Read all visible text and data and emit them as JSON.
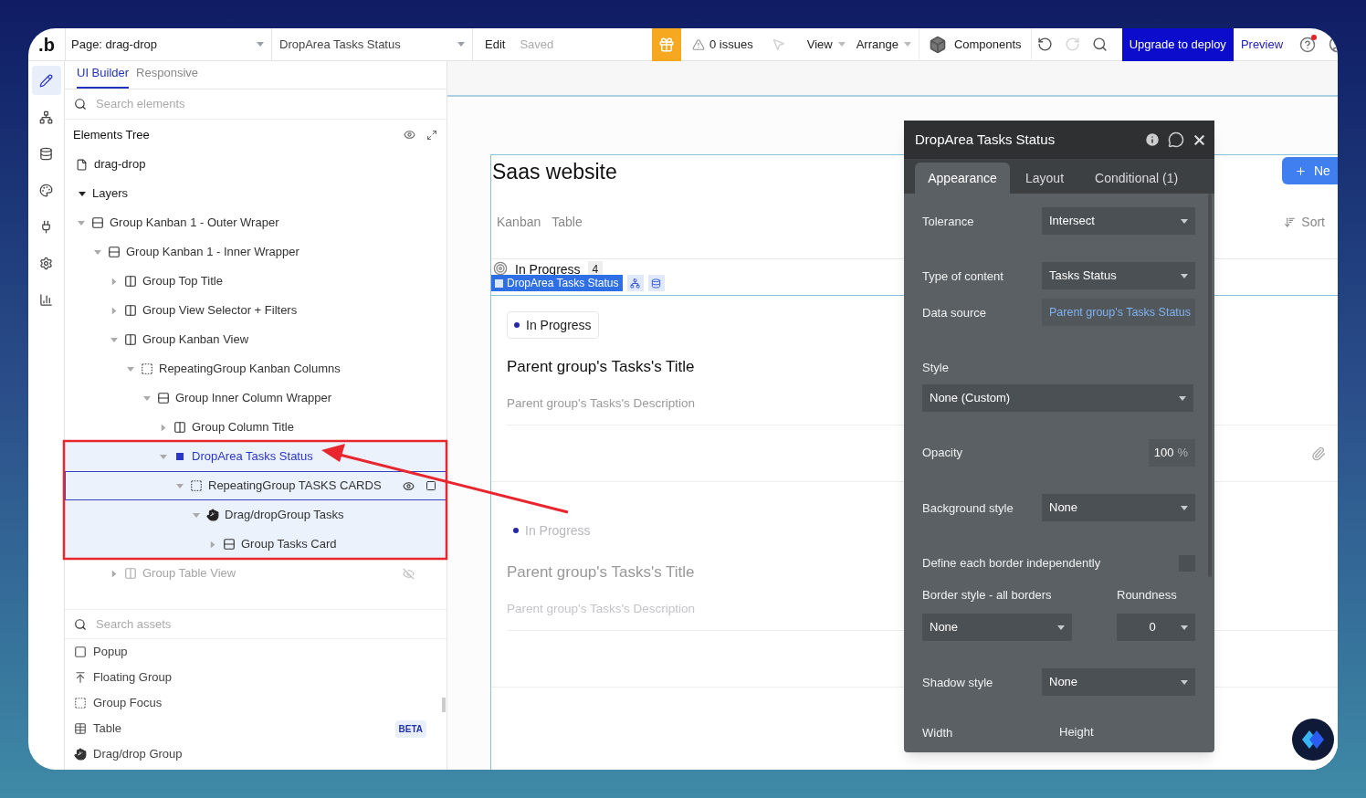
{
  "topbar": {
    "logo": ".b",
    "page_select": "Page: drag-drop",
    "element_select": "DropArea Tasks Status",
    "edit": "Edit",
    "save_status": "Saved",
    "issues": "0 issues",
    "menus": [
      "View",
      "Arrange"
    ],
    "components": "Components",
    "tools": [
      {
        "kind": "undo",
        "disabled": false
      },
      {
        "kind": "redo",
        "disabled": true
      },
      {
        "kind": "search",
        "disabled": false
      }
    ],
    "upgrade": "Upgrade to deploy",
    "preview": "Preview",
    "help_notification": true
  },
  "rail": [
    {
      "kind": "design",
      "selected": true
    },
    {
      "kind": "workflow",
      "selected": false
    },
    {
      "kind": "data",
      "selected": false
    },
    {
      "kind": "styles",
      "selected": false
    },
    {
      "kind": "plugins",
      "selected": false
    },
    {
      "kind": "settings",
      "selected": false
    },
    {
      "kind": "logs",
      "selected": false
    }
  ],
  "left_panel": {
    "tabs": [
      {
        "label": "UI Builder",
        "selected": true
      },
      {
        "label": "Responsive",
        "selected": false
      }
    ],
    "search": {
      "placeholder": "Search elements"
    },
    "tree_title": "Elements Tree",
    "page": "drag-drop",
    "layers": {
      "label": "Layers",
      "expanded": true,
      "children": [
        {
          "label": "Group Kanban 1 - Outer Wraper",
          "kind": "group",
          "expanded": true,
          "selected": false,
          "hovered": false,
          "hidden": false,
          "children": [
            {
              "label": "Group Kanban 1 - Inner Wrapper",
              "kind": "group",
              "expanded": true,
              "selected": false,
              "hovered": false,
              "hidden": false,
              "children": [
                {
                  "label": "Group Top Title",
                  "kind": "column",
                  "expanded": false,
                  "selected": false,
                  "hovered": false,
                  "hidden": false
                },
                {
                  "label": "Group View Selector + Filters",
                  "kind": "column",
                  "expanded": false,
                  "selected": false,
                  "hovered": false,
                  "hidden": false
                },
                {
                  "label": "Group Kanban View",
                  "kind": "column",
                  "expanded": true,
                  "selected": false,
                  "hovered": false,
                  "hidden": false,
                  "children": [
                    {
                      "label": "RepeatingGroup Kanban Columns",
                      "kind": "repeating",
                      "expanded": true,
                      "selected": false,
                      "hovered": false,
                      "hidden": false,
                      "children": [
                        {
                          "label": "Group Inner Column Wrapper",
                          "kind": "group",
                          "expanded": true,
                          "selected": false,
                          "hovered": false,
                          "hidden": false,
                          "children": [
                            {
                              "label": "Group Column Title",
                              "kind": "column",
                              "expanded": false,
                              "selected": false,
                              "hovered": false,
                              "hidden": false
                            },
                            {
                              "label": "DropArea Tasks Status",
                              "kind": "droparea",
                              "expanded": true,
                              "selected": true,
                              "hovered": false,
                              "hidden": false,
                              "children": [
                                {
                                  "label": "RepeatingGroup TASKS CARDS",
                                  "kind": "repeating",
                                  "expanded": true,
                                  "selected": false,
                                  "hovered": true,
                                  "hidden": false,
                                  "children": [
                                    {
                                      "label": "Drag/dropGroup Tasks",
                                      "kind": "dragdrop",
                                      "expanded": true,
                                      "selected": false,
                                      "hovered": false,
                                      "hidden": false,
                                      "children": [
                                        {
                                          "label": "Group Tasks Card",
                                          "kind": "group",
                                          "expanded": false,
                                          "selected": false,
                                          "hovered": false,
                                          "hidden": false
                                        }
                                      ]
                                    }
                                  ]
                                }
                              ]
                            }
                          ]
                        }
                      ]
                    }
                  ]
                },
                {
                  "label": "Group Table View",
                  "kind": "column",
                  "expanded": false,
                  "selected": false,
                  "hovered": false,
                  "hidden": true
                }
              ]
            }
          ]
        }
      ]
    },
    "assets_search": {
      "placeholder": "Search assets"
    },
    "assets": [
      {
        "label": "Popup",
        "kind": "popup"
      },
      {
        "label": "Floating Group",
        "kind": "floating"
      },
      {
        "label": "Group Focus",
        "kind": "focus"
      },
      {
        "label": "Table",
        "kind": "table",
        "badge": "BETA"
      },
      {
        "label": "Drag/drop Group",
        "kind": "dragdrop"
      }
    ]
  },
  "canvas": {
    "page_title": "Saas website",
    "new_button": "Ne",
    "views": [
      "Kanban",
      "Table"
    ],
    "sort": "Sort",
    "column": {
      "title": "In Progress",
      "count": "4"
    },
    "element_tag": "DropArea Tasks Status",
    "cards": [
      {
        "status": "In Progress",
        "color": "#2626a8",
        "title": "Parent group's Tasks's Title",
        "description": "Parent group's Tasks's Description",
        "faded": false
      },
      {
        "status": "In Progress",
        "color": "#2626a8",
        "title": "Parent group's Tasks's Title",
        "description": "Parent group's Tasks's Description",
        "faded": true
      }
    ]
  },
  "panel": {
    "title": "DropArea Tasks Status",
    "tabs": [
      {
        "label": "Appearance",
        "selected": true
      },
      {
        "label": "Layout",
        "selected": false
      },
      {
        "label": "Conditional (1)",
        "selected": false
      }
    ],
    "fields": [
      {
        "kind": "select",
        "label": "Tolerance",
        "value": "Intersect"
      },
      {
        "kind": "select",
        "label": "Type of content",
        "value": "Tasks Status"
      },
      {
        "kind": "expression",
        "label": "Data source",
        "value": "Parent group's Tasks Status"
      },
      {
        "kind": "stacked",
        "label": "Style",
        "value": "None (Custom)"
      },
      {
        "kind": "number",
        "label": "Opacity",
        "value": "100",
        "unit": "%"
      },
      {
        "kind": "select",
        "label": "Background style",
        "value": "None"
      },
      {
        "kind": "checkbox",
        "label": "Define each border independently",
        "checked": false
      },
      {
        "kind": "pair",
        "label": "Border style - all borders",
        "value": "None",
        "label2": "Roundness",
        "value2": "0"
      },
      {
        "kind": "select",
        "label": "Shadow style",
        "value": "None"
      },
      {
        "kind": "sizes",
        "label": "Width",
        "label2": "Height"
      }
    ]
  }
}
